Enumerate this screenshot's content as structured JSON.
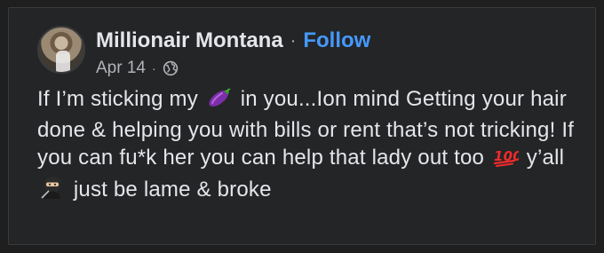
{
  "post": {
    "author": "Millionair Montana",
    "separator": "·",
    "follow_label": "Follow",
    "date": "Apr 14",
    "date_separator": "·",
    "privacy_icon": "globe-icon",
    "text_segments": [
      "If I’m sticking my ",
      " in you...Ion mind Getting your hair done & helping you with bills or rent that’s not tricking! If you can fu*k her you can help that lady out too ",
      " y’all ",
      " just be lame & broke"
    ],
    "emojis": [
      "eggplant-emoji",
      "hundred-points-emoji",
      "ninja-emoji"
    ]
  },
  "colors": {
    "background": "#1f1f1f",
    "card": "#242526",
    "text": "#e4e6eb",
    "secondary": "#b0b3b8",
    "link": "#4599ff"
  }
}
